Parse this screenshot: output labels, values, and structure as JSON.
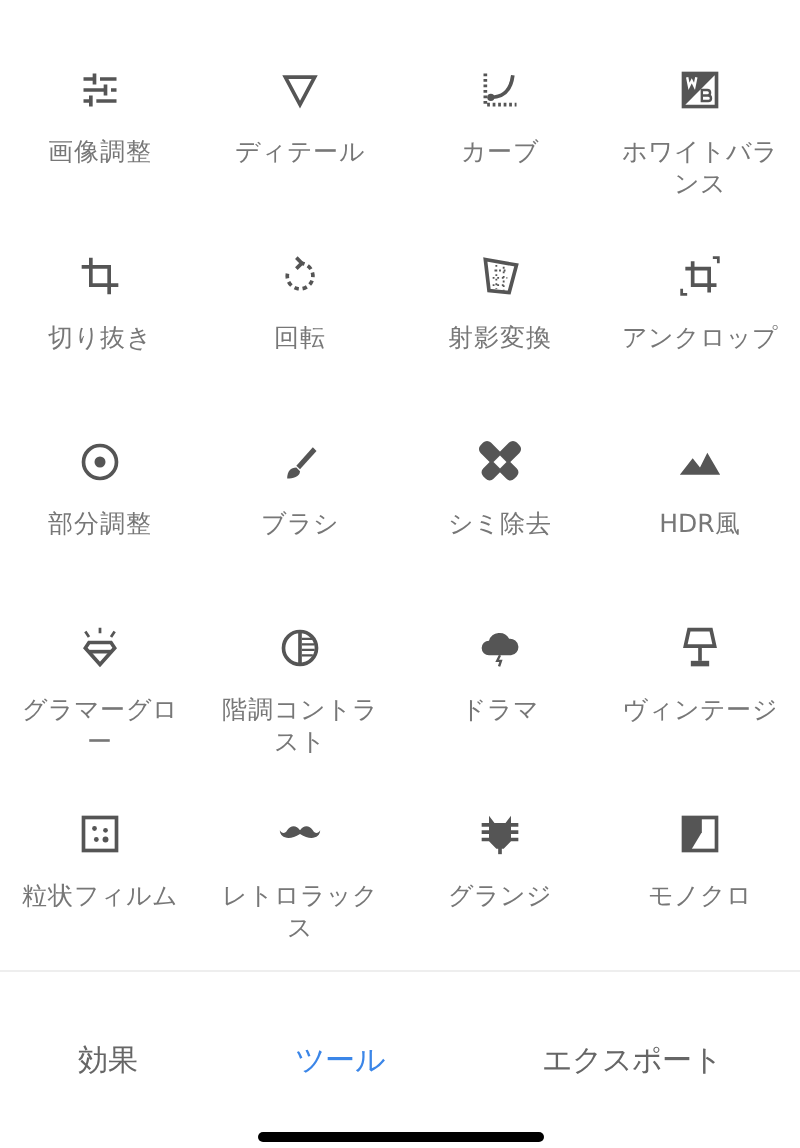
{
  "tools": [
    {
      "label": "画像調整",
      "kind": "sliders"
    },
    {
      "label": "ディテール",
      "kind": "triangle"
    },
    {
      "label": "カーブ",
      "kind": "curve"
    },
    {
      "label": "ホワイトバランス",
      "kind": "wb"
    },
    {
      "label": "切り抜き",
      "kind": "crop"
    },
    {
      "label": "回転",
      "kind": "rotate"
    },
    {
      "label": "射影変換",
      "kind": "perspective"
    },
    {
      "label": "アンクロップ",
      "kind": "expand"
    },
    {
      "label": "部分調整",
      "kind": "target"
    },
    {
      "label": "ブラシ",
      "kind": "brush"
    },
    {
      "label": "シミ除去",
      "kind": "bandage"
    },
    {
      "label": "HDR風",
      "kind": "mountains"
    },
    {
      "label": "グラマーグロー",
      "kind": "diamond"
    },
    {
      "label": "階調コントラスト",
      "kind": "contrast"
    },
    {
      "label": "ドラマ",
      "kind": "cloud"
    },
    {
      "label": "ヴィンテージ",
      "kind": "lamp"
    },
    {
      "label": "粒状フィルム",
      "kind": "grain"
    },
    {
      "label": "レトロラックス",
      "kind": "mustache"
    },
    {
      "label": "グランジ",
      "kind": "guitar"
    },
    {
      "label": "モノクロ",
      "kind": "mono"
    }
  ],
  "tabs": [
    {
      "label": "効果",
      "selected": false
    },
    {
      "label": "ツール",
      "selected": true
    },
    {
      "label": "エクスポート",
      "selected": false
    }
  ]
}
